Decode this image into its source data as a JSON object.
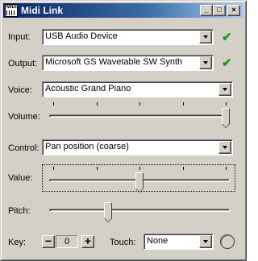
{
  "window": {
    "title": "Midi Link",
    "icon": "midi-keyboard-icon",
    "controls": {
      "minimize": "_",
      "maximize": "□",
      "close": "×"
    }
  },
  "input": {
    "label": "Input:",
    "value": "USB Audio Device",
    "status_icon": "green-check-icon"
  },
  "output": {
    "label": "Output:",
    "value": "Microsoft GS Wavetable SW Synth",
    "status_icon": "green-check-icon"
  },
  "voice": {
    "label": "Voice:",
    "value": "Acoustic Grand Piano"
  },
  "volume": {
    "label": "Volume:",
    "level": 1.0,
    "ticks": 5
  },
  "control": {
    "label": "Control:",
    "value": "Pan position (coarse)"
  },
  "value": {
    "label": "Value:",
    "level": 0.5,
    "ticks": 5
  },
  "pitch": {
    "label": "Pitch:",
    "level": 0.32
  },
  "key": {
    "label": "Key:",
    "value": "0",
    "decrement": "−",
    "increment": "+"
  },
  "touch": {
    "label": "Touch:",
    "value": "None"
  },
  "colors": {
    "check": "#1a9a1a",
    "titlebar_start": "#0a246a",
    "titlebar_end": "#a6caf0"
  }
}
